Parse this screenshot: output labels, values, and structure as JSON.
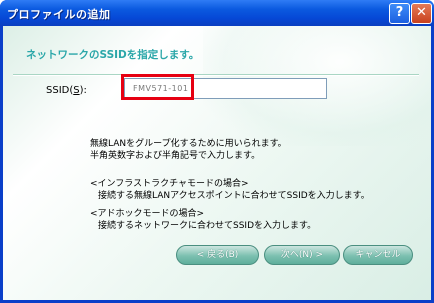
{
  "window": {
    "title": "プロファイルの追加",
    "help_label": "?",
    "close_label": "✕"
  },
  "page": {
    "heading": "ネットワークのSSIDを指定します。"
  },
  "ssid": {
    "label": "SSID(",
    "accel": "S",
    "label_end": "):",
    "value": "FMV571-101"
  },
  "info": {
    "line1": "無線LANをグループ化するために用いられます。",
    "line2": "半角英数字および半角記号で入力します。",
    "infra_title": "<インフラストラクチャモードの場合>",
    "infra_body": "接続する無線LANアクセスポイントに合わせてSSIDを入力します。",
    "adhoc_title": "<アドホックモードの場合>",
    "adhoc_body": "接続するネットワークに合わせてSSIDを入力します。"
  },
  "buttons": {
    "back": "< 戻る(B)",
    "next": "次へ(N) >",
    "cancel": "キャンセル"
  },
  "colors": {
    "titlebar": "#0b5ae0",
    "heading": "#2ba7a9",
    "highlight": "#e60012",
    "button": "#7cc0b0"
  }
}
